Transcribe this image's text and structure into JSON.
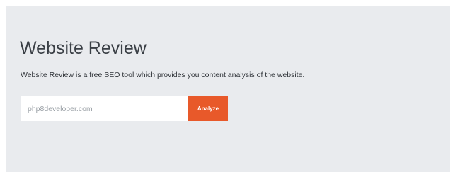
{
  "review": {
    "title": "Website Review",
    "description": "Website Review is a free SEO tool which provides you content analysis of the website.",
    "input_placeholder": "php8developer.com",
    "input_value": "",
    "analyze_label": "Analyze"
  },
  "colors": {
    "panel_background": "#e9ebee",
    "accent_button": "#e8592a"
  }
}
